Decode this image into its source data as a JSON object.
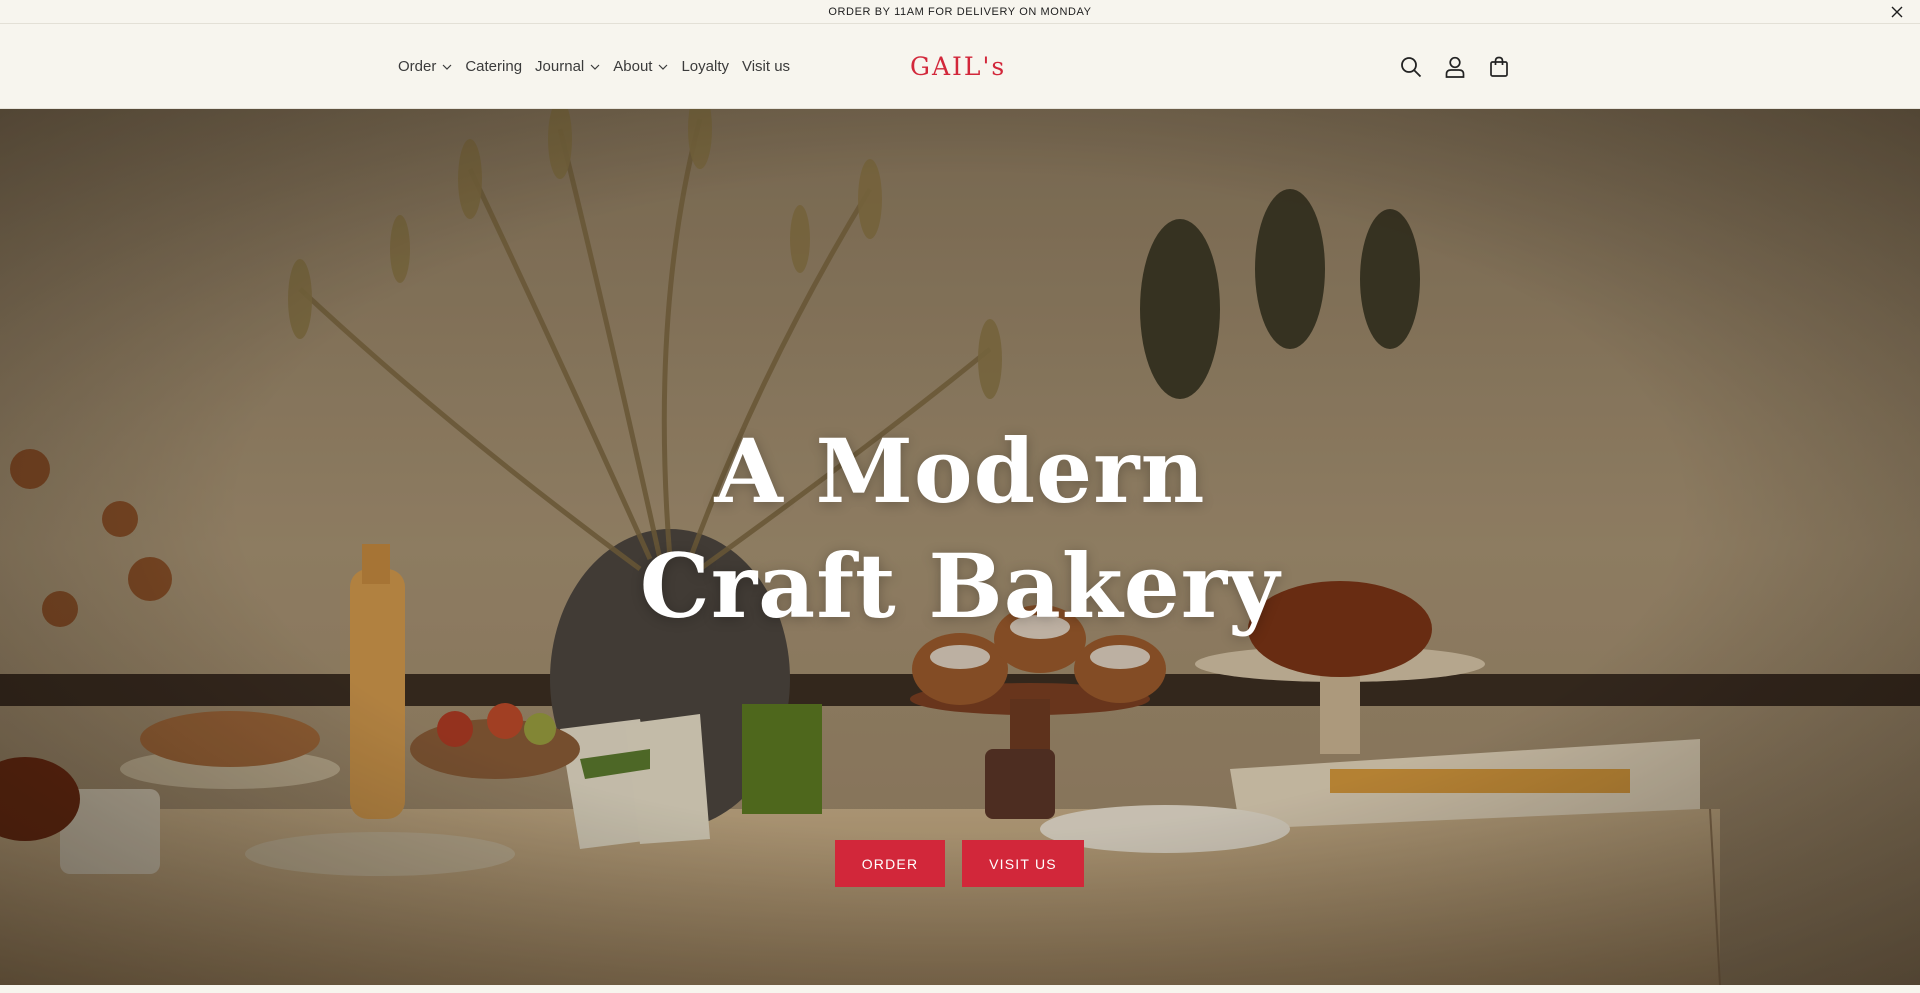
{
  "announcement": {
    "text": "ORDER BY 11AM FOR DELIVERY ON MONDAY",
    "close_icon": "close-icon"
  },
  "nav": {
    "items": [
      {
        "label": "Order",
        "has_dropdown": true
      },
      {
        "label": "Catering",
        "has_dropdown": false
      },
      {
        "label": "Journal",
        "has_dropdown": true
      },
      {
        "label": "About",
        "has_dropdown": true
      },
      {
        "label": "Loyalty",
        "has_dropdown": false
      },
      {
        "label": "Visit us",
        "has_dropdown": false
      }
    ]
  },
  "brand": {
    "logo_text": "GAIL's",
    "color": "#d2273a"
  },
  "header_icons": [
    "search-icon",
    "account-icon",
    "cart-icon"
  ],
  "hero": {
    "title_line1": "A Modern",
    "title_line2": "Craft Bakery",
    "buttons": {
      "order": "ORDER",
      "visit": "VISIT US"
    },
    "button_color": "#d2273a"
  }
}
